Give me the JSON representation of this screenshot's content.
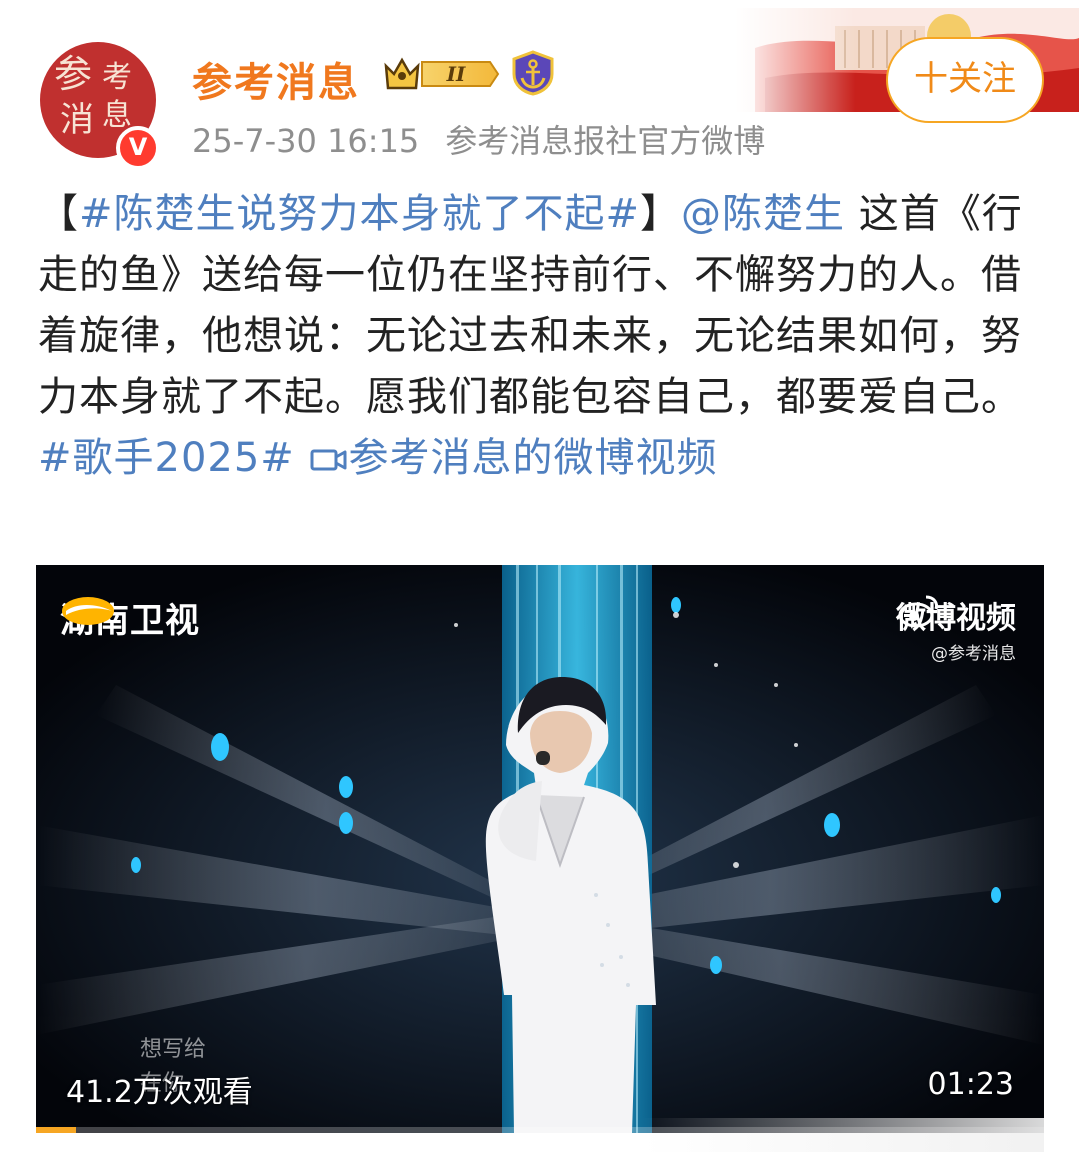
{
  "header": {
    "account_name": "参考消息",
    "level_badge": "II",
    "timestamp": "25-7-30 16:15",
    "source": "参考消息报社官方微博",
    "verified_mark": "V",
    "follow_label": "十关注",
    "avatar_text": [
      "参",
      "考",
      "消",
      "息"
    ]
  },
  "post": {
    "topic": "#陈楚生说努力本身就了不起#",
    "bracket_open": "【",
    "bracket_close": "】",
    "mention": "@陈楚生",
    "text_1": " 这首《行走的鱼》送给每一位仍在坚持前行、不懈努力的人。借着旋律，他想说：无论过去和未来，无论结果如何，努力本身就了不起。愿我们都能包容自己，都要爱自己。",
    "hashtag": "#歌手2025#",
    "video_link_icon": "video-icon",
    "video_link": "参考消息的微博视频"
  },
  "video": {
    "channel_logo_text": "湖南卫视",
    "watermark_top": "微博视频",
    "watermark_sub": "@参考消息",
    "lyric_line_1": "想写给",
    "lyric_line_2": "在你",
    "views": "41.2万次观看",
    "duration": "01:23",
    "progress": 0.04
  },
  "colors": {
    "name_orange": "#f0781e",
    "link_blue": "#4f7fbf",
    "follow_border": "#f6a623",
    "badge_red": "#ff3b2f"
  }
}
